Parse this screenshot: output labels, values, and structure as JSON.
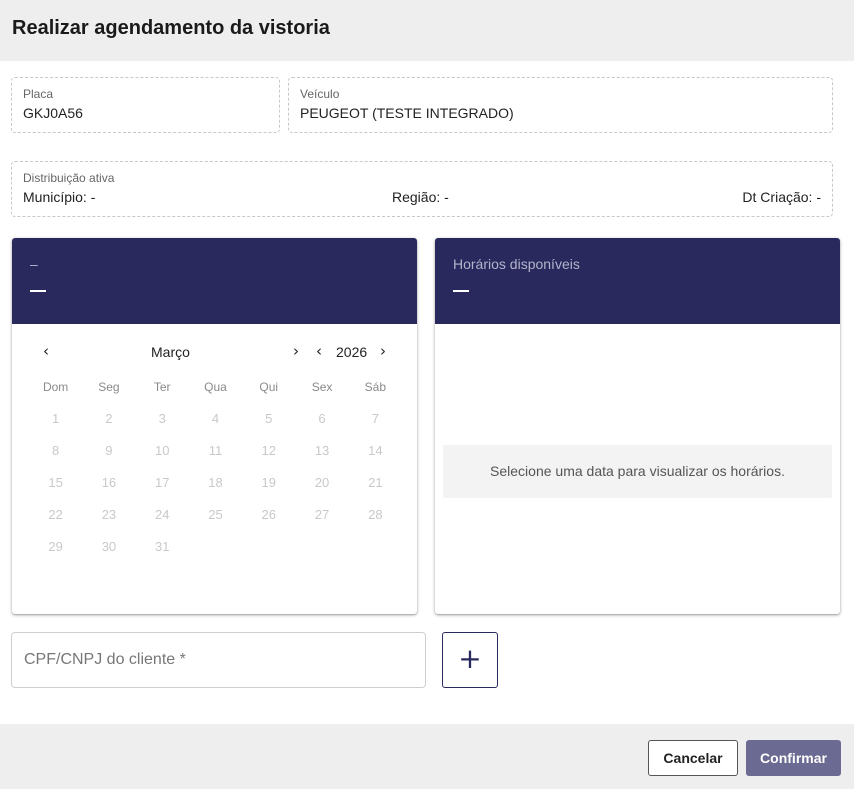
{
  "dialog": {
    "title": "Realizar agendamento da vistoria"
  },
  "placa": {
    "label": "Placa",
    "value": "GKJ0A56"
  },
  "veiculo": {
    "label": "Veículo",
    "value": "PEUGEOT (TESTE INTEGRADO)"
  },
  "distribuicao": {
    "label": "Distribuição ativa",
    "municipio": "Município: -",
    "regiao": "Região: -",
    "dt_criacao": "Dt Criação: -"
  },
  "calendar": {
    "banner_small": "–",
    "month": "Março",
    "year": "2026",
    "prev_month": "‹",
    "next_month": "›",
    "prev_year": "‹",
    "next_year": "›",
    "weekdays": [
      "Dom",
      "Seg",
      "Ter",
      "Qua",
      "Qui",
      "Sex",
      "Sáb"
    ],
    "weeks": [
      [
        "1",
        "2",
        "3",
        "4",
        "5",
        "6",
        "7"
      ],
      [
        "8",
        "9",
        "10",
        "11",
        "12",
        "13",
        "14"
      ],
      [
        "15",
        "16",
        "17",
        "18",
        "19",
        "20",
        "21"
      ],
      [
        "22",
        "23",
        "24",
        "25",
        "26",
        "27",
        "28"
      ],
      [
        "29",
        "30",
        "31"
      ]
    ]
  },
  "hours": {
    "title": "Horários disponíveis",
    "empty_message": "Selecione uma data para visualizar os horários."
  },
  "cpf": {
    "placeholder": "CPF/CNPJ do cliente *"
  },
  "add_button": {
    "icon": "plus-icon",
    "label": "+"
  },
  "footer": {
    "cancel": "Cancelar",
    "confirm": "Confirmar"
  },
  "colors": {
    "primary": "#29295e",
    "confirm": "#6a6a92",
    "header_bg": "#eeeeee"
  }
}
